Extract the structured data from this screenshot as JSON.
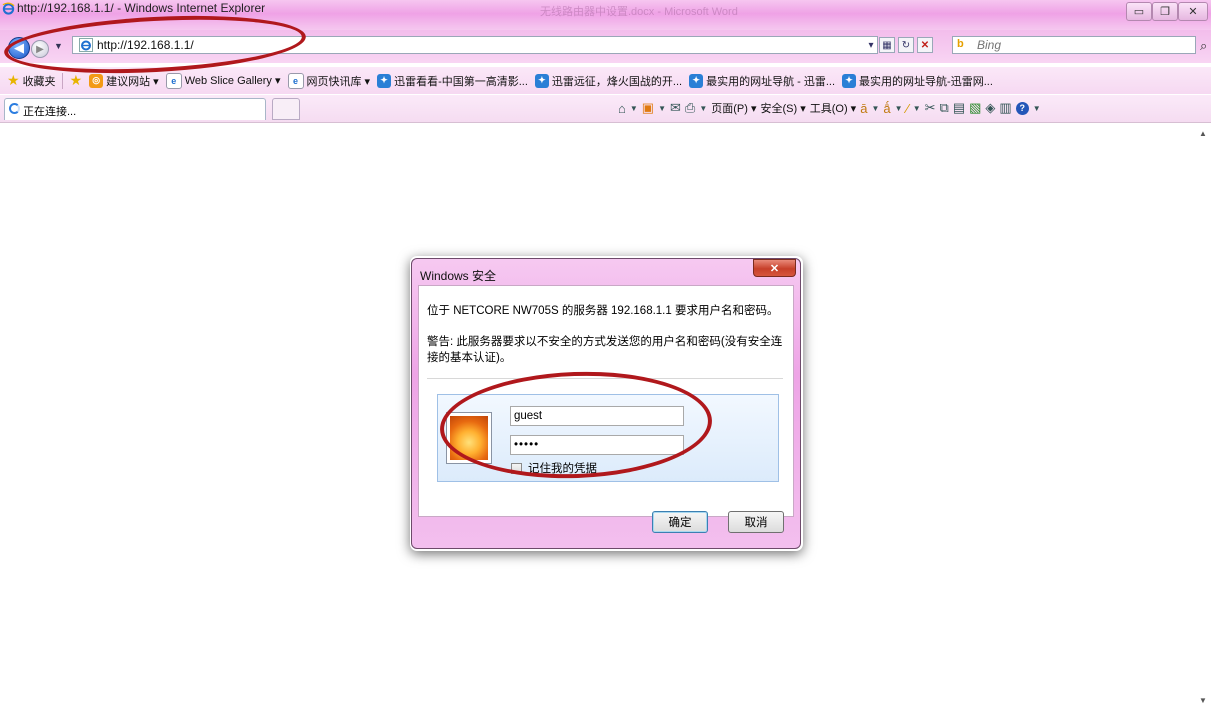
{
  "window": {
    "title": "http://192.168.1.1/ - Windows Internet Explorer",
    "center_title": "无线路由器中设置.docx - Microsoft Word"
  },
  "nav": {
    "address": "http://192.168.1.1/",
    "search_placeholder": "Bing",
    "bing_logo": "b"
  },
  "favorites": {
    "label": "收藏夹",
    "items": [
      "建议网站 ▾",
      "Web Slice Gallery ▾",
      "网页快讯库 ▾",
      "迅雷看看-中国第一高清影...",
      "迅雷远征，烽火国战的开...",
      "最实用的网址导航 - 迅雷...",
      "最实用的网址导航-迅雷网..."
    ]
  },
  "tab": {
    "label": "正在连接..."
  },
  "commands": {
    "page": "页面(P) ▾",
    "safety": "安全(S) ▾",
    "tools": "工具(O) ▾"
  },
  "dialog": {
    "title": "Windows 安全",
    "message": "位于 NETCORE NW705S 的服务器 192.168.1.1 要求用户名和密码。",
    "warning": "警告: 此服务器要求以不安全的方式发送您的用户名和密码(没有安全连接的基本认证)。",
    "username": "guest",
    "password": "•••••",
    "remember_label": "记住我的凭据",
    "ok_label": "确定",
    "cancel_label": "取消"
  },
  "colors": {
    "frame_pink": "#efa2e6",
    "annotation_red": "#b0181c",
    "close_red": "#c7402a"
  }
}
